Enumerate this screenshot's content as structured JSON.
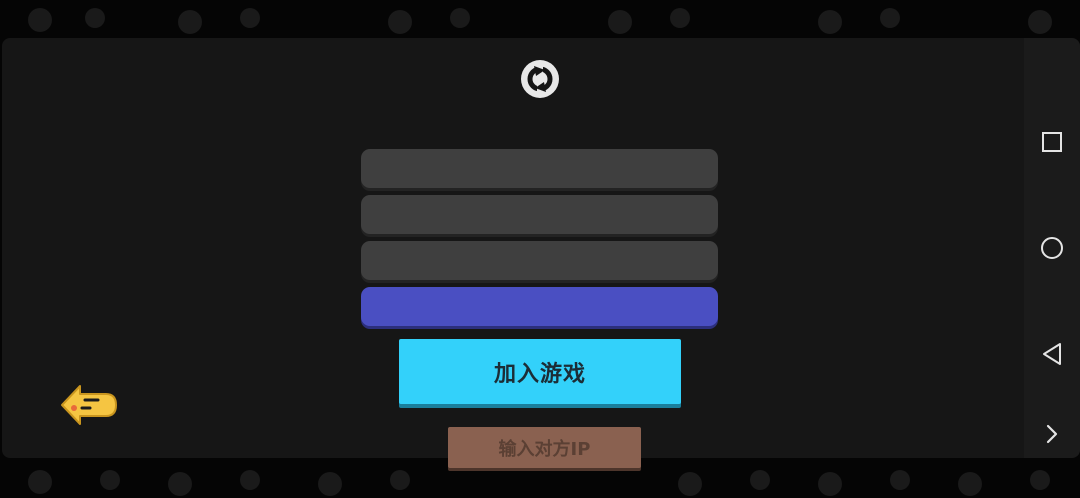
{
  "form": {
    "field_1_value": "",
    "field_2_value": "",
    "field_3_value": "",
    "join_label": "加入游戏",
    "ip_label": "输入对方IP"
  },
  "colors": {
    "panel": "#161616",
    "field": "#3f3f3f",
    "field_accent": "#4a4fc2",
    "join_button": "#33d1fa",
    "ip_button": "#8a6150",
    "back_arrow": "#f5c542"
  },
  "icons": {
    "refresh": "refresh-icon",
    "back": "back-arrow-icon",
    "nav_recents": "square-icon",
    "nav_home": "circle-icon",
    "nav_back": "triangle-back-icon",
    "nav_more": "chevron-right-icon"
  }
}
